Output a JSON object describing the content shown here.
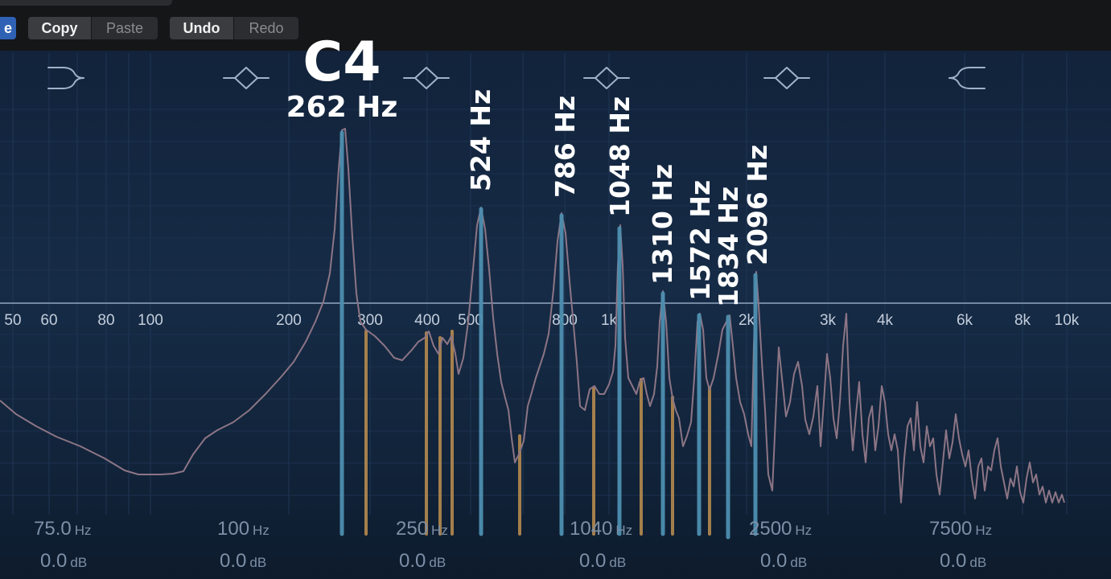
{
  "toolbar": {
    "partial_button_label": "e",
    "copy_label": "Copy",
    "paste_label": "Paste",
    "undo_label": "Undo",
    "redo_label": "Redo"
  },
  "annotations": {
    "note_name": "C4",
    "fundamental": "262 Hz",
    "harmonics": [
      "524 Hz",
      "786 Hz",
      "1048 Hz",
      "1310 Hz",
      "1572 Hz",
      "1834 Hz",
      "2096 Hz"
    ]
  },
  "freq_axis": {
    "tick_labels": [
      "50",
      "60",
      "80",
      "100",
      "200",
      "300",
      "400",
      "500",
      "800",
      "1k",
      "2k",
      "3k",
      "4k",
      "6k",
      "8k",
      "10k"
    ]
  },
  "bands": [
    {
      "freq": "75.0",
      "freq_unit": "Hz",
      "gain": "0.0",
      "gain_unit": "dB"
    },
    {
      "freq": "100",
      "freq_unit": "Hz",
      "gain": "0.0",
      "gain_unit": "dB"
    },
    {
      "freq": "250",
      "freq_unit": "Hz",
      "gain": "0.0",
      "gain_unit": "dB"
    },
    {
      "freq": "1040",
      "freq_unit": "Hz",
      "gain": "0.0",
      "gain_unit": "dB"
    },
    {
      "freq": "2500",
      "freq_unit": "Hz",
      "gain": "0.0",
      "gain_unit": "dB"
    },
    {
      "freq": "7500",
      "freq_unit": "Hz",
      "gain": "0.0",
      "gain_unit": "dB"
    }
  ],
  "colors": {
    "harmonic_marker": "#4d8fb0",
    "inharmonic_marker": "#b58a4e",
    "spectrum_line": "#8c7585",
    "zero_line": "#a9bfd6"
  }
}
